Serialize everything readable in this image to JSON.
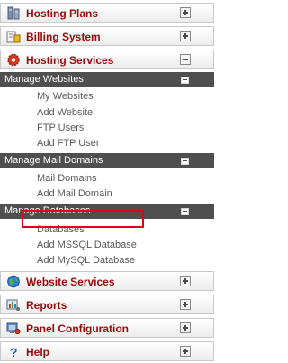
{
  "sections": {
    "hosting_plans": "Hosting Plans",
    "billing_system": "Billing System",
    "hosting_services": "Hosting Services",
    "website_services": "Website Services",
    "reports": "Reports",
    "panel_configuration": "Panel Configuration",
    "help": "Help"
  },
  "subsections": {
    "manage_websites": {
      "title": "Manage Websites",
      "items": [
        "My Websites",
        "Add Website",
        "FTP Users",
        "Add FTP User"
      ]
    },
    "manage_mail_domains": {
      "title": "Manage Mail Domains",
      "items": [
        "Mail Domains",
        "Add Mail Domain"
      ]
    },
    "manage_databases": {
      "title": "Manage Databases",
      "items": [
        "Databases",
        "Add MSSQL Database",
        "Add MySQL Database"
      ]
    }
  },
  "colors": {
    "section_text": "#9b0a0a",
    "subsection_bg": "#4f4f4f",
    "highlight": "#e0001b"
  },
  "icons": {
    "hosting_plans": "server-tower-icon",
    "billing_system": "billing-icon",
    "hosting_services": "gear-icon",
    "website_services": "globe-icon",
    "reports": "reports-icon",
    "panel_configuration": "panel-configuration-icon",
    "help": "help-icon"
  }
}
